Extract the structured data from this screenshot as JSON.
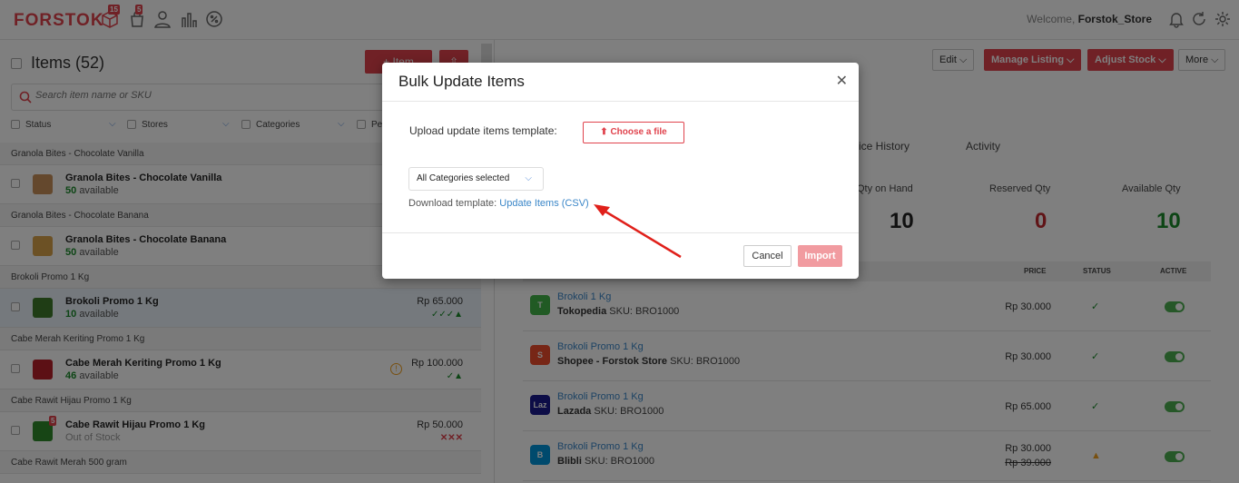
{
  "topbar": {
    "logo": "FORSTOK",
    "badge_orders": "15",
    "badge_items": "5",
    "welcome_prefix": "Welcome,",
    "store_name": "Forstok_Store"
  },
  "left": {
    "items_title": "Items (52)",
    "add_item_label": "+ Item",
    "search_placeholder": "Search item name or SKU",
    "filters": [
      "Status",
      "Stores",
      "Categories",
      "Pe"
    ],
    "groups": [
      {
        "group": "Granola Bites - Chocolate Vanilla",
        "name": "Granola Bites - Chocolate Vanilla",
        "qty": "50",
        "avail": "available",
        "price": "",
        "status": ""
      },
      {
        "group": "Granola Bites - Chocolate Banana",
        "name": "Granola Bites - Chocolate Banana",
        "qty": "50",
        "avail": "available",
        "price": "",
        "status": ""
      },
      {
        "group": "Brokoli Promo 1 Kg",
        "name": "Brokoli Promo 1 Kg",
        "qty": "10",
        "avail": "available",
        "price": "Rp 65.000",
        "status": "✓✓✓▲"
      },
      {
        "group": "Cabe Merah Keriting Promo 1 Kg",
        "name": "Cabe Merah Keriting Promo 1 Kg",
        "qty": "46",
        "avail": "available",
        "price": "Rp 100.000",
        "status": "✓▲"
      },
      {
        "group": "Cabe Rawit Hijau Promo 1 Kg",
        "name": "Cabe Rawit Hijau Promo 1 Kg",
        "qty": "",
        "avail": "Out of Stock",
        "price": "Rp 50.000",
        "status": "✕✕✕"
      }
    ],
    "last_group": "Cabe Rawit Merah 500 gram",
    "thumb_badge": "5"
  },
  "right": {
    "buttons": {
      "edit": "Edit",
      "manage": "Manage Listing",
      "adjust": "Adjust Stock",
      "more": "More"
    },
    "tabs": [
      "ice History",
      "Activity"
    ],
    "qty": {
      "on_hand_label": "Qty on Hand",
      "on_hand": "10",
      "reserved_label": "Reserved Qty",
      "reserved": "0",
      "available_label": "Available Qty",
      "available": "10"
    },
    "table_headers": {
      "price": "PRICE",
      "status": "STATUS",
      "active": "ACTIVE"
    },
    "listings": [
      {
        "name": "Brokoli 1 Kg",
        "store": "Tokopedia",
        "sku": "SKU: BRO1000",
        "price": "Rp  30.000",
        "old_price": "",
        "status": "✓",
        "color": "#42b549",
        "icon": "tokopedia-icon"
      },
      {
        "name": "Brokoli Promo 1 Kg",
        "store": "Shopee - Forstok Store",
        "sku": "SKU: BRO1000",
        "price": "Rp  30.000",
        "old_price": "",
        "status": "✓",
        "color": "#ee4d2d",
        "icon": "shopee-icon"
      },
      {
        "name": "Brokoli Promo 1 Kg",
        "store": "Lazada",
        "sku": "SKU: BRO1000",
        "price": "Rp  65.000",
        "old_price": "",
        "status": "✓",
        "color": "#1a1a8f",
        "icon": "lazada-icon"
      },
      {
        "name": "Brokoli Promo 1 Kg",
        "store": "Blibli",
        "sku": "SKU: BRO1000",
        "price": "Rp 30.000",
        "old_price": "Rp  39.000",
        "status": "▲",
        "color": "#0095da",
        "icon": "blibli-icon"
      }
    ]
  },
  "modal": {
    "title": "Bulk Update Items",
    "upload_label": "Upload update items template:",
    "choose_file": "Choose a file",
    "category_select": "All Categories selected",
    "download_prefix": "Download template:",
    "download_link": "Update Items (CSV)",
    "cancel": "Cancel",
    "import": "Import"
  },
  "colors": {
    "accent": "#e0434d",
    "link": "#3a86c8",
    "success": "#1a8a2a"
  }
}
